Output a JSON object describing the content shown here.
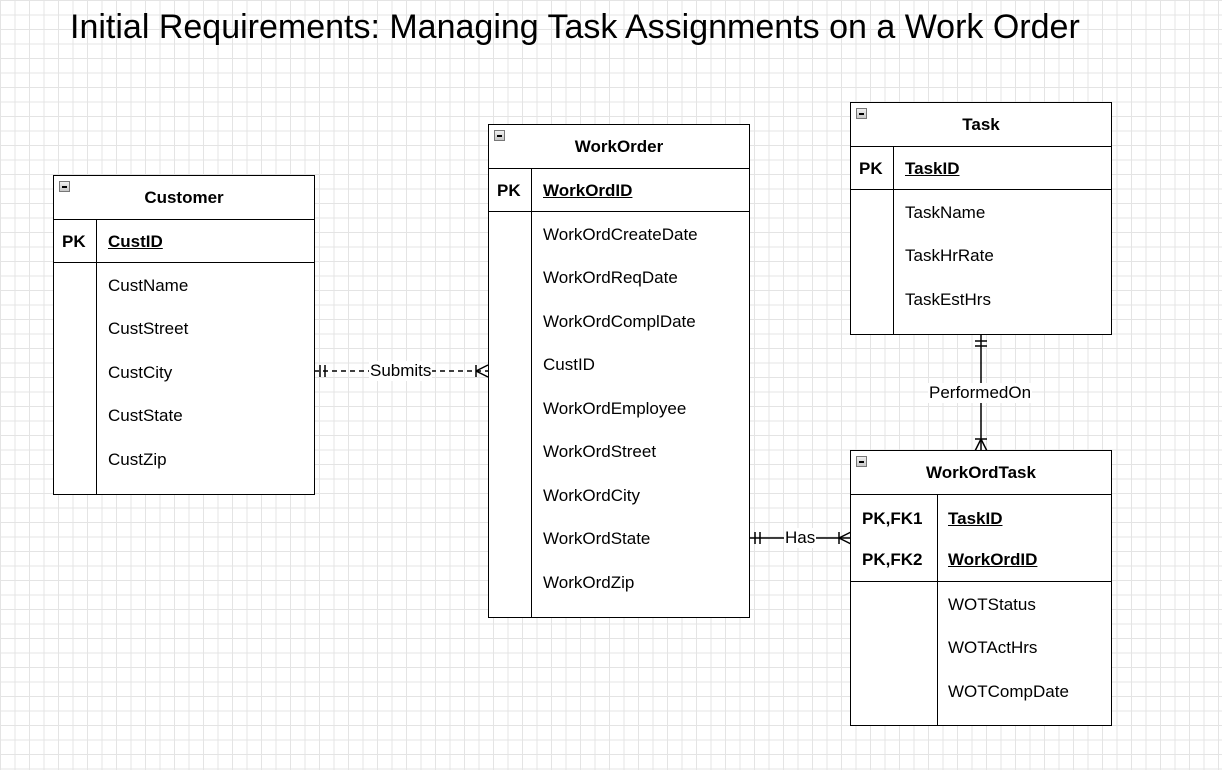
{
  "title": "Initial Requirements: Managing Task Assignments on a Work Order",
  "entities": {
    "customer": {
      "name": "Customer",
      "pk_label": "PK",
      "pk_field": "CustID",
      "fields": [
        "CustName",
        "CustStreet",
        "CustCity",
        "CustState",
        "CustZip"
      ]
    },
    "workorder": {
      "name": "WorkOrder",
      "pk_label": "PK",
      "pk_field": "WorkOrdID",
      "fields": [
        "WorkOrdCreateDate",
        "WorkOrdReqDate",
        "WorkOrdComplDate",
        "CustID",
        "WorkOrdEmployee",
        "WorkOrdStreet",
        "WorkOrdCity",
        "WorkOrdState",
        "WorkOrdZip"
      ]
    },
    "task": {
      "name": "Task",
      "pk_label": "PK",
      "pk_field": "TaskID",
      "fields": [
        "TaskName",
        "TaskHrRate",
        "TaskEstHrs"
      ]
    },
    "workordtask": {
      "name": "WorkOrdTask",
      "keys": [
        {
          "label": "PK,FK1",
          "field": "TaskID"
        },
        {
          "label": "PK,FK2",
          "field": "WorkOrdID"
        }
      ],
      "fields": [
        "WOTStatus",
        "WOTActHrs",
        "WOTCompDate"
      ]
    }
  },
  "relationships": {
    "submits": "Submits",
    "has": "Has",
    "performed_on": "PerformedOn"
  }
}
